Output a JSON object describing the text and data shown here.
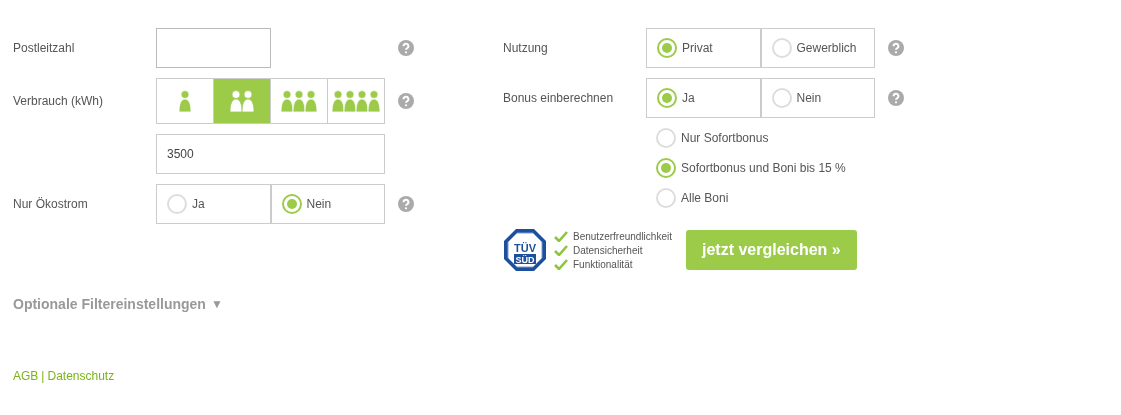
{
  "left": {
    "postcode": {
      "label": "Postleitzahl"
    },
    "consumption": {
      "label": "Verbrauch (kWh)",
      "options": [
        {
          "selected": false
        },
        {
          "selected": true
        },
        {
          "selected": false
        },
        {
          "selected": false
        }
      ],
      "value": "3500"
    },
    "eco": {
      "label": "Nur Ökostrom",
      "options": [
        {
          "label": "Ja",
          "selected": false
        },
        {
          "label": "Nein",
          "selected": true
        }
      ]
    }
  },
  "right": {
    "usage": {
      "label": "Nutzung",
      "options": [
        {
          "label": "Privat",
          "selected": true
        },
        {
          "label": "Gewerblich",
          "selected": false
        }
      ]
    },
    "bonus": {
      "label": "Bonus einberechnen",
      "options": [
        {
          "label": "Ja",
          "selected": true
        },
        {
          "label": "Nein",
          "selected": false
        }
      ],
      "sub_options": [
        {
          "label": "Nur Sofortbonus",
          "selected": false
        },
        {
          "label": "Sofortbonus und Boni bis 15 %",
          "selected": true
        },
        {
          "label": "Alle Boni",
          "selected": false
        }
      ]
    }
  },
  "seal": {
    "text": "TÜV",
    "subtext": "SÜD"
  },
  "checks": [
    "Benutzerfreundlichkeit",
    "Datensicherheit",
    "Funktionalität"
  ],
  "submit": "jetzt vergleichen »",
  "optional_filters": {
    "label": "Optionale Filtereinstellungen",
    "arrow": "▼"
  },
  "footer_links": [
    "AGB",
    "Datenschutz"
  ],
  "footer_separator": "|"
}
